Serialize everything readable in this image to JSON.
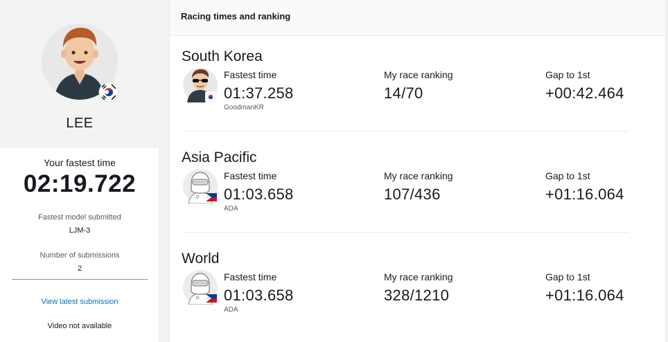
{
  "profile": {
    "name": "LEE",
    "fastest_time_label": "Your fastest time",
    "fastest_time": "02:19.722",
    "model_label": "Fastest model submitted",
    "model_value": "LJM-3",
    "submissions_label": "Number of submissions",
    "submissions_value": "2",
    "latest_link": "View latest submission",
    "video_text": "Video not available"
  },
  "panel": {
    "title": "Racing times and ranking",
    "labels": {
      "fastest": "Fastest time",
      "ranking": "My race ranking",
      "gap": "Gap to 1st"
    },
    "sections": [
      {
        "title": "South Korea",
        "fastest_time": "01:37.258",
        "racer": "GoodmanKR",
        "ranking": "14/70",
        "gap": "+00:42.464"
      },
      {
        "title": "Asia Pacific",
        "fastest_time": "01:03.658",
        "racer": "ADA",
        "ranking": "107/436",
        "gap": "+01:16.064"
      },
      {
        "title": "World",
        "fastest_time": "01:03.658",
        "racer": "ADA",
        "ranking": "328/1210",
        "gap": "+01:16.064"
      }
    ]
  },
  "icons": {
    "profile_avatar": "user-avatar-icon",
    "flag_kr": "south-korea-flag-icon",
    "flag_ph": "philippines-flag-icon",
    "helmet": "racer-helmet-avatar-icon"
  },
  "colors": {
    "link": "#0073bb",
    "sidebar_bg": "#f2f3f3"
  }
}
